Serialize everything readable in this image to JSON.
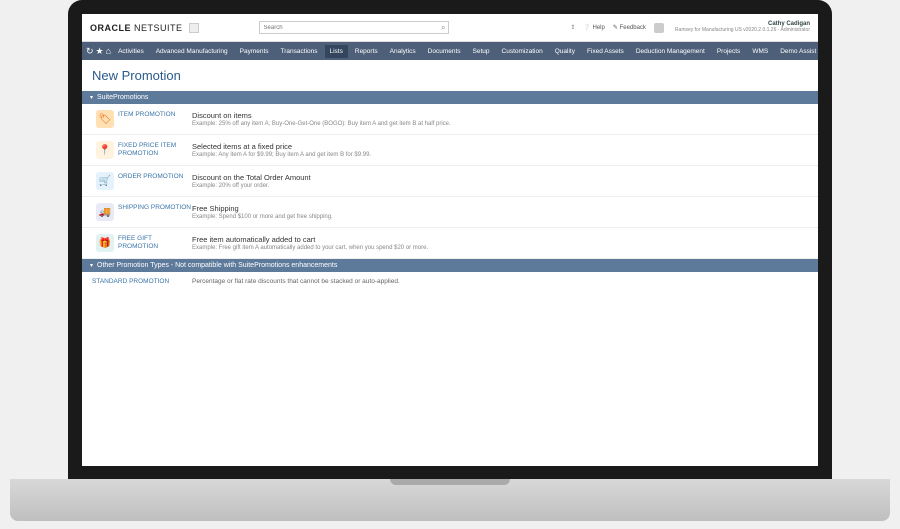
{
  "brand": {
    "text1": "ORACLE",
    "text2": " NETSUITE"
  },
  "search": {
    "placeholder": "Search"
  },
  "header_links": {
    "help": "Help",
    "feedback": "Feedback"
  },
  "user": {
    "name": "Cathy Cadigan",
    "role": "Ramsey for Manufacturing US v2020.2.0.1.26 - Administrator"
  },
  "nav": {
    "items": [
      "Activities",
      "Advanced Manufacturing",
      "Payments",
      "Transactions",
      "Lists",
      "Reports",
      "Analytics",
      "Documents",
      "Setup",
      "Customization",
      "Quality",
      "Fixed Assets",
      "Deduction Management",
      "Projects",
      "WMS",
      "Demo Assist"
    ],
    "active_index": 4
  },
  "page_title": "New Promotion",
  "section1_label": "SuitePromotions",
  "promotions": [
    {
      "icon_class": "ic-tag",
      "icon_glyph": "🏷",
      "link": "ITEM PROMOTION",
      "title": "Discount on items",
      "example": "Example: 25% off any item A; Buy-One-Get-One (BOGO): Buy item A and get item B at half price."
    },
    {
      "icon_class": "ic-fixed",
      "icon_glyph": "📍",
      "link": "FIXED PRICE ITEM PROMOTION",
      "title": "Selected items at a fixed price",
      "example": "Example: Any item A for $9.99; Buy item A and get item B for $9.99."
    },
    {
      "icon_class": "ic-cart",
      "icon_glyph": "🛒",
      "link": "ORDER PROMOTION",
      "title": "Discount on the Total Order Amount",
      "example": "Example: 20% off your order."
    },
    {
      "icon_class": "ic-ship",
      "icon_glyph": "🚚",
      "link": "SHIPPING PROMOTION",
      "title": "Free Shipping",
      "example": "Example: Spend $100 or more and get free shipping."
    },
    {
      "icon_class": "ic-gift",
      "icon_glyph": "🎁",
      "link": "FREE GIFT PROMOTION",
      "title": "Free item automatically added to cart",
      "example": "Example: Free gift item A automatically added to your cart, when you spend $20 or more."
    }
  ],
  "section2_label": "Other Promotion Types - Not compatible with SuitePromotions enhancements",
  "standard": {
    "link": "STANDARD PROMOTION",
    "desc": "Percentage or flat rate discounts that cannot be stacked or auto-applied."
  }
}
